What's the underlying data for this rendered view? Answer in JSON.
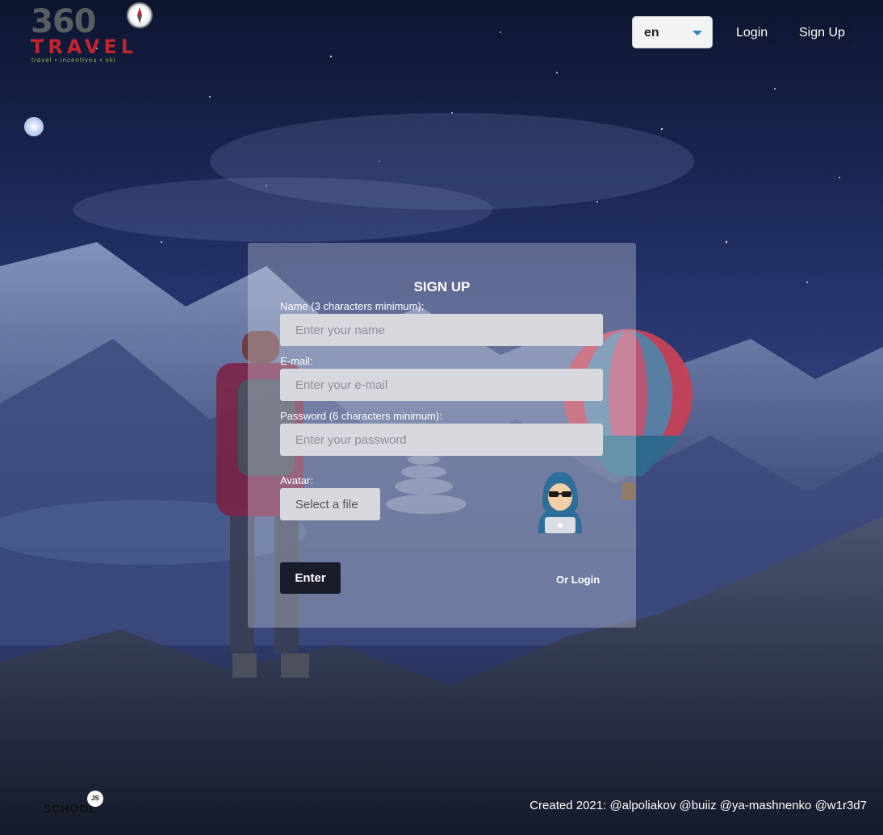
{
  "header": {
    "logo": {
      "number": "360",
      "word": "TRAVEL",
      "tagline": "travel • incentives • ski"
    },
    "language": {
      "selected": "en"
    },
    "nav": {
      "login": "Login",
      "signup": "Sign Up"
    }
  },
  "form": {
    "title": "SIGN UP",
    "name": {
      "label": "Name (3 characters minimum):",
      "placeholder": "Enter your name",
      "value": ""
    },
    "email": {
      "label": "E-mail:",
      "placeholder": "Enter your e-mail",
      "value": ""
    },
    "password": {
      "label": "Password (6 characters minimum):",
      "placeholder": "Enter your password",
      "value": ""
    },
    "avatar": {
      "label": "Avatar:",
      "button": "Select a file"
    },
    "submit": "Enter",
    "alt_link": "Or Login"
  },
  "footer": {
    "school_logo": {
      "text": "SCHOOL",
      "badge": "JS"
    },
    "credits": "Created 2021: @alpoliakov @buiiz @ya-mashnenko @w1r3d7"
  },
  "icons": {
    "avatar": "hacker-avatar-icon",
    "compass": "compass-icon",
    "caret": "caret-down-icon"
  },
  "colors": {
    "logo_red": "#c0252f",
    "logo_gray": "#5a5d62",
    "enter_button": "#181c2b",
    "caret": "#2a86c7"
  }
}
